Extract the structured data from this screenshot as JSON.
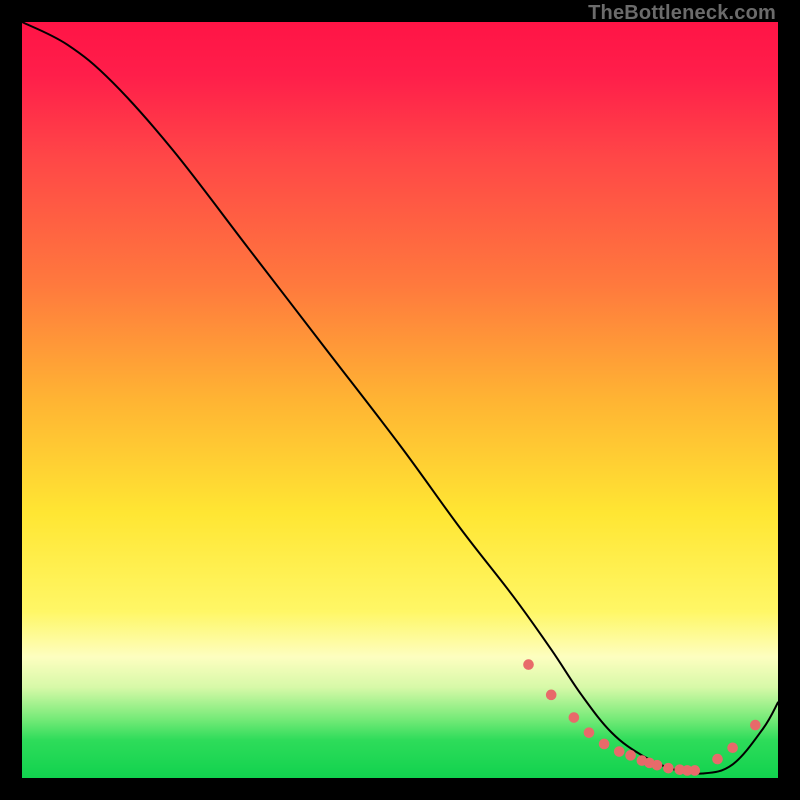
{
  "watermark": "TheBottleneck.com",
  "chart_data": {
    "type": "line",
    "title": "",
    "xlabel": "",
    "ylabel": "",
    "xlim": [
      0,
      100
    ],
    "ylim": [
      0,
      100
    ],
    "grid": false,
    "curve": {
      "name": "bottleneck-curve",
      "color": "#000000",
      "x": [
        0,
        6,
        12,
        20,
        30,
        40,
        50,
        58,
        65,
        70,
        74,
        78,
        82,
        86,
        90,
        94,
        98,
        100
      ],
      "y": [
        100,
        97,
        92,
        83,
        70,
        57,
        44,
        33,
        24,
        17,
        11,
        6,
        3,
        1.2,
        0.6,
        1.8,
        6.5,
        10
      ]
    },
    "scatter": {
      "name": "marker-points",
      "color": "#e86a6a",
      "radius": 5.3,
      "points": [
        {
          "x": 67,
          "y": 15
        },
        {
          "x": 70,
          "y": 11
        },
        {
          "x": 73,
          "y": 8
        },
        {
          "x": 75,
          "y": 6
        },
        {
          "x": 77,
          "y": 4.5
        },
        {
          "x": 79,
          "y": 3.5
        },
        {
          "x": 80.5,
          "y": 3
        },
        {
          "x": 82,
          "y": 2.3
        },
        {
          "x": 83,
          "y": 2
        },
        {
          "x": 84,
          "y": 1.7
        },
        {
          "x": 85.5,
          "y": 1.3
        },
        {
          "x": 87,
          "y": 1.1
        },
        {
          "x": 88,
          "y": 1.0
        },
        {
          "x": 89,
          "y": 1.0
        },
        {
          "x": 92,
          "y": 2.5
        },
        {
          "x": 94,
          "y": 4
        },
        {
          "x": 97,
          "y": 7
        }
      ]
    }
  }
}
